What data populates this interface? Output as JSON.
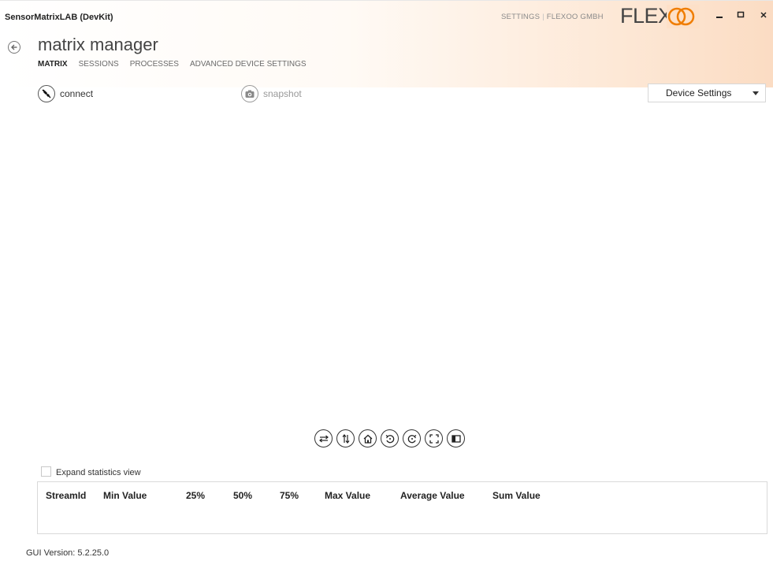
{
  "app": {
    "window_title": "SensorMatrixLAB (DevKit)",
    "top_links": [
      "SETTINGS",
      "FLEXOO GMBH"
    ],
    "logo_text": "FLEXOO",
    "brand_color": "#f07d00",
    "window_controls": [
      "minimize-icon",
      "maximize-icon",
      "close-icon"
    ]
  },
  "page": {
    "title": "matrix manager",
    "back_icon": "back-arrow-icon"
  },
  "tabs": [
    {
      "label": "MATRIX",
      "active": true
    },
    {
      "label": "SESSIONS",
      "active": false
    },
    {
      "label": "PROCESSES",
      "active": false
    },
    {
      "label": "ADVANCED DEVICE SETTINGS",
      "active": false
    }
  ],
  "toolbar": {
    "connect_label": "connect",
    "connect_icon": "disconnected-plug-icon",
    "snapshot_label": "snapshot",
    "snapshot_icon": "camera-icon",
    "device_settings_selected": "Device Settings"
  },
  "plot_tools": [
    "swap-horizontal-icon",
    "swap-vertical-icon",
    "home-icon",
    "rotate-left-icon",
    "rotate-right-icon",
    "fullscreen-icon",
    "panel-toggle-icon"
  ],
  "statistics": {
    "expand_label": "Expand statistics view",
    "expanded": false,
    "columns": [
      "StreamId",
      "Min Value",
      "25%",
      "50%",
      "75%",
      "Max Value",
      "Average Value",
      "Sum Value"
    ],
    "rows": []
  },
  "footer": {
    "version": "GUI Version: 5.2.25.0"
  }
}
